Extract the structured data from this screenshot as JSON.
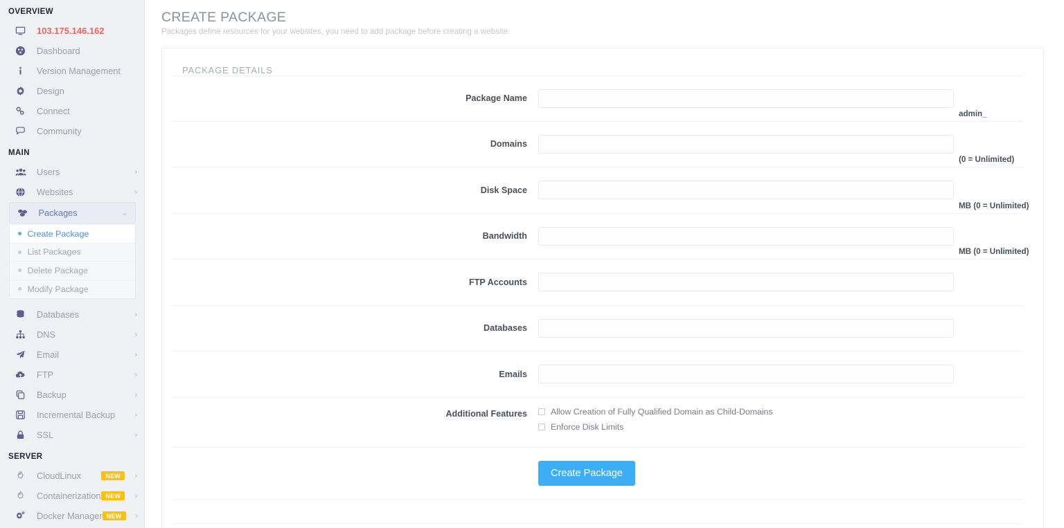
{
  "sidebar": {
    "sections": [
      {
        "title": "OVERVIEW",
        "items": [
          {
            "label": "103.175.146.162",
            "icon": "monitor-icon",
            "kind": "ip"
          },
          {
            "label": "Dashboard",
            "icon": "dashboard-icon"
          },
          {
            "label": "Version Management",
            "icon": "info-icon"
          },
          {
            "label": "Design",
            "icon": "gear-icon"
          },
          {
            "label": "Connect",
            "icon": "link-icon"
          },
          {
            "label": "Community",
            "icon": "chat-icon"
          }
        ]
      },
      {
        "title": "MAIN",
        "items": [
          {
            "label": "Users",
            "icon": "users-icon",
            "chevron": "›"
          },
          {
            "label": "Websites",
            "icon": "globe-icon",
            "chevron": "›"
          },
          {
            "label": "Packages",
            "icon": "packages-icon",
            "chevron": "⌄",
            "expanded": true,
            "children": [
              {
                "label": "Create Package",
                "active": true
              },
              {
                "label": "List Packages",
                "active": false
              },
              {
                "label": "Delete Package",
                "active": false
              },
              {
                "label": "Modify Package",
                "active": false
              }
            ]
          },
          {
            "label": "Databases",
            "icon": "database-icon",
            "chevron": "›"
          },
          {
            "label": "DNS",
            "icon": "sitemap-icon",
            "chevron": "›"
          },
          {
            "label": "Email",
            "icon": "send-icon",
            "chevron": "›"
          },
          {
            "label": "FTP",
            "icon": "cloud-upload-icon",
            "chevron": "›"
          },
          {
            "label": "Backup",
            "icon": "copy-icon",
            "chevron": "›"
          },
          {
            "label": "Incremental Backup",
            "icon": "save-icon",
            "chevron": "›"
          },
          {
            "label": "SSL",
            "icon": "lock-icon",
            "chevron": "›"
          }
        ]
      },
      {
        "title": "SERVER",
        "items": [
          {
            "label": "CloudLinux",
            "icon": "flame-icon",
            "badge": "NEW",
            "chevron": "›"
          },
          {
            "label": "Containerization",
            "icon": "flame-icon",
            "badge": "NEW",
            "chevron": "›"
          },
          {
            "label": "Docker Manager",
            "icon": "cogs-icon",
            "badge": "NEW",
            "chevron": "›"
          }
        ]
      }
    ]
  },
  "page": {
    "title": "CREATE PACKAGE",
    "subtitle": "Packages define resources for your websites, you need to add package before creating a website."
  },
  "card": {
    "title": "PACKAGE DETAILS",
    "fields": [
      {
        "label": "Package Name",
        "value": "",
        "placeholder": "",
        "suffix": "admin_"
      },
      {
        "label": "Domains",
        "value": "",
        "placeholder": "",
        "suffix": "(0 = Unlimited)"
      },
      {
        "label": "Disk Space",
        "value": "",
        "placeholder": "",
        "suffix": "MB (0 = Unlimited)"
      },
      {
        "label": "Bandwidth",
        "value": "",
        "placeholder": "",
        "suffix": "MB (0 = Unlimited)"
      },
      {
        "label": "FTP Accounts",
        "value": "",
        "placeholder": "",
        "suffix": ""
      },
      {
        "label": "Databases",
        "value": "",
        "placeholder": "",
        "suffix": ""
      },
      {
        "label": "Emails",
        "value": "",
        "placeholder": "",
        "suffix": ""
      }
    ],
    "features": {
      "label": "Additional Features",
      "checkboxes": [
        {
          "label": "Allow Creation of Fully Qualified Domain as Child-Domains",
          "checked": false
        },
        {
          "label": "Enforce Disk Limits",
          "checked": false
        }
      ]
    },
    "submit_label": "Create Package"
  },
  "colors": {
    "accent_blue": "#3daef3",
    "sidebar_bg": "#eff1f5",
    "ip_red": "#e8675a",
    "badge_yellow": "#fdc00f",
    "active_link": "#4e8fd0"
  }
}
